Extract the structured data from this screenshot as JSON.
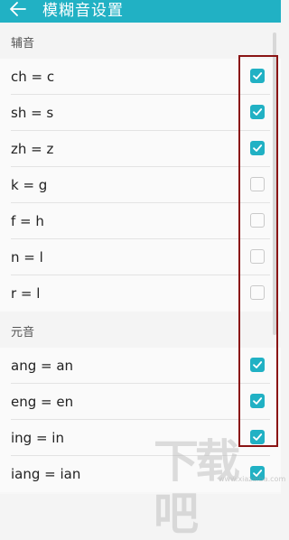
{
  "appbar": {
    "back_icon": "arrow-left-icon",
    "title": "模糊音设置"
  },
  "sections": [
    {
      "header": "辅音",
      "items": [
        {
          "label": "ch = c",
          "checked": true
        },
        {
          "label": "sh = s",
          "checked": true
        },
        {
          "label": "zh = z",
          "checked": true
        },
        {
          "label": "k = g",
          "checked": false
        },
        {
          "label": "f = h",
          "checked": false
        },
        {
          "label": "n = l",
          "checked": false
        },
        {
          "label": "r = l",
          "checked": false
        }
      ]
    },
    {
      "header": "元音",
      "items": [
        {
          "label": "ang = an",
          "checked": true
        },
        {
          "label": "eng = en",
          "checked": true
        },
        {
          "label": "ing = in",
          "checked": true
        },
        {
          "label": "iang = ian",
          "checked": true
        }
      ]
    }
  ],
  "watermark": {
    "text": "下载吧",
    "url": "www.xiazaiba.com"
  },
  "colors": {
    "accent": "#21b1c4",
    "highlight": "#8a1414"
  }
}
